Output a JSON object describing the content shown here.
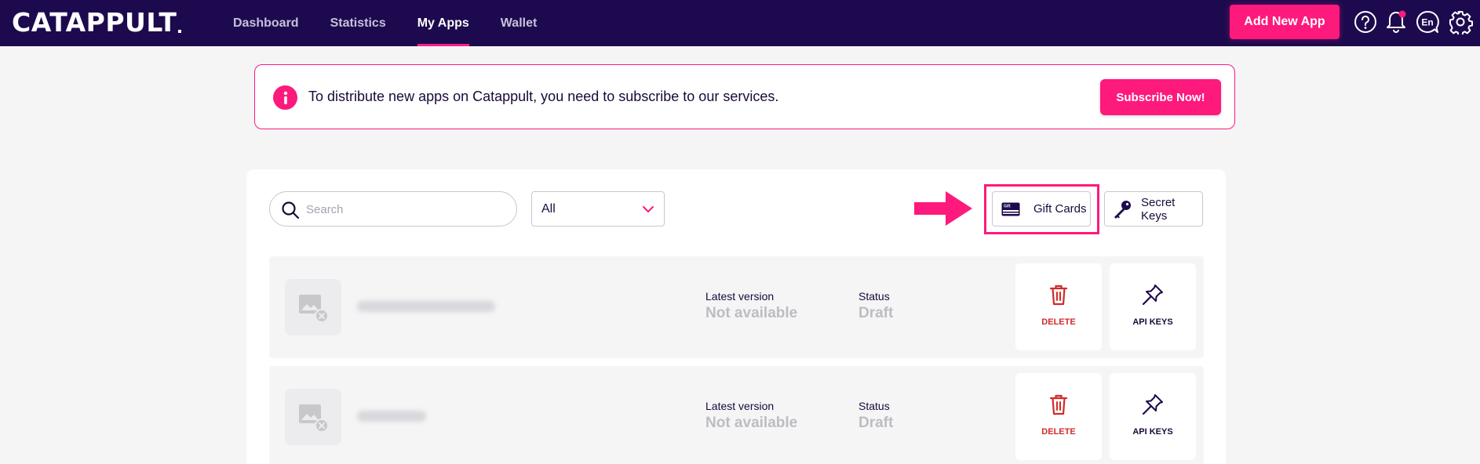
{
  "header": {
    "logo_text": "CATAPPULT",
    "nav": [
      {
        "label": "Dashboard",
        "active": false
      },
      {
        "label": "Statistics",
        "active": false
      },
      {
        "label": "My Apps",
        "active": true
      },
      {
        "label": "Wallet",
        "active": false
      }
    ],
    "add_app_label": "Add New App",
    "language_label": "En",
    "icons": [
      "help-icon",
      "notification-bell-icon",
      "language-icon",
      "settings-gear-icon"
    ]
  },
  "banner": {
    "message": "To distribute new apps on Catappult, you need to subscribe to our services.",
    "button_label": "Subscribe Now!"
  },
  "toolbar": {
    "search_placeholder": "Search",
    "filter_value": "All",
    "gift_cards_label": "Gift Cards",
    "gift_icon_text": "Gift",
    "secret_keys_label": "Secret Keys"
  },
  "apps": [
    {
      "latest_version_label": "Latest version",
      "latest_version_value": "Not available",
      "status_label": "Status",
      "status_value": "Draft",
      "delete_label": "DELETE",
      "api_keys_label": "API KEYS"
    },
    {
      "latest_version_label": "Latest version",
      "latest_version_value": "Not available",
      "status_label": "Status",
      "status_value": "Draft",
      "delete_label": "DELETE",
      "api_keys_label": "API KEYS"
    }
  ],
  "colors": {
    "nav_bg": "#1d0a4e",
    "accent": "#fe197c",
    "delete_red": "#d32a2a"
  }
}
